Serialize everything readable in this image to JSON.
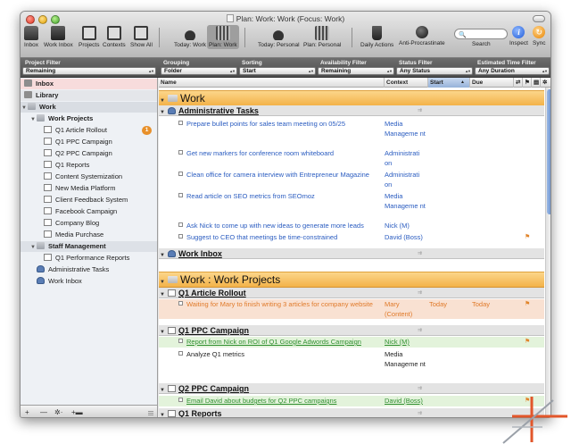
{
  "window": {
    "title": "Plan: Work: Work (Focus: Work)"
  },
  "toolbar": {
    "items": [
      {
        "label": "Inbox",
        "icon": "inbox-icon"
      },
      {
        "label": "Work Inbox",
        "icon": "work-inbox-icon"
      },
      {
        "label": "Projects",
        "icon": "projects-icon"
      },
      {
        "label": "Contexts",
        "icon": "contexts-icon"
      },
      {
        "label": "Show All",
        "icon": "show-all-icon"
      },
      {
        "label": "Today: Work",
        "icon": "flame-icon"
      },
      {
        "label": "Plan: Work",
        "icon": "plan-icon"
      },
      {
        "label": "Today: Personal",
        "icon": "flame-icon"
      },
      {
        "label": "Plan: Personal",
        "icon": "plan-icon"
      },
      {
        "label": "Daily Actions",
        "icon": "coffee-icon"
      },
      {
        "label": "Anti-Procrastinate",
        "icon": "ball-icon"
      },
      {
        "label": "Search",
        "icon": "search-icon"
      },
      {
        "label": "Inspect",
        "icon": "info-icon"
      },
      {
        "label": "Sync",
        "icon": "sync-icon"
      }
    ],
    "search_placeholder": "",
    "search_glyph": "🔍",
    "info_glyph": "i",
    "sync_glyph": "↻"
  },
  "filters": {
    "project_filter": {
      "label": "Project Filter",
      "value": "Remaining"
    },
    "grouping": {
      "label": "Grouping",
      "value": "Folder"
    },
    "sorting": {
      "label": "Sorting",
      "value": "Start"
    },
    "availability": {
      "label": "Availability Filter",
      "value": "Remaining"
    },
    "status": {
      "label": "Status Filter",
      "value": "Any Status"
    },
    "estimated": {
      "label": "Estimated Time Filter",
      "value": "Any Duration"
    }
  },
  "sidebar": {
    "inbox": "Inbox",
    "library": "Library",
    "work": "Work",
    "work_projects": "Work Projects",
    "items": [
      {
        "label": "Q1 Article Rollout",
        "badge": "1"
      },
      {
        "label": "Q1 PPC Campaign"
      },
      {
        "label": "Q2 PPC Campaign"
      },
      {
        "label": "Q1 Reports"
      },
      {
        "label": "Content Systemization"
      },
      {
        "label": "New Media Platform"
      },
      {
        "label": "Client Feedback System"
      },
      {
        "label": "Facebook Campaign"
      },
      {
        "label": "Company Blog"
      },
      {
        "label": "Media Purchase"
      }
    ],
    "staff_management": "Staff Management",
    "staff_items": [
      {
        "label": "Q1 Performance Reports"
      }
    ],
    "admin_tasks": "Administrative Tasks",
    "work_inbox": "Work Inbox",
    "bottom": {
      "add": "+",
      "remove": "—",
      "gear": "✲·",
      "add_folder": "+▬"
    }
  },
  "columns": {
    "name": "Name",
    "context": "Context",
    "start": "Start",
    "due": "Due"
  },
  "outline": {
    "band1": "Work",
    "admin_group": "Administrative Tasks",
    "admin_tasks": [
      {
        "name": "Prepare bullet points for sales team meeting on 05/25",
        "context": "Media Manageme nt"
      },
      {
        "name": "Get new markers for conference room whiteboard",
        "context": "Administrati on"
      },
      {
        "name": "Clean office for camera interview with Entrepreneur Magazine",
        "context": "Administrati on"
      },
      {
        "name": "Read article on SEO metrics from SEOmoz",
        "context": "Media Manageme nt"
      },
      {
        "name": "Ask Nick to come up with new ideas to generate more leads",
        "context": "Nick (M)"
      },
      {
        "name": "Suggest to CEO that meetings be time-constrained",
        "context": "David (Boss)",
        "flag": "⚑"
      }
    ],
    "work_inbox_group": "Work Inbox",
    "band2": "Work : Work Projects",
    "q1_article_group": "Q1 Article Rollout",
    "q1_article_tasks": [
      {
        "name": "Waiting for Mary to finish writing 3 articles for company website",
        "context": "Mary (Content)",
        "start": "Today",
        "due": "Today",
        "flag": "⚑"
      }
    ],
    "q1_ppc_group": "Q1 PPC Campaign",
    "q1_ppc_tasks": [
      {
        "name": "Report from Nick on ROI of Q1 Google Adwords Campaign",
        "context": "Nick (M)",
        "flag": "⚑"
      },
      {
        "name": "Analyze Q1 metrics",
        "context": "Media Manageme nt"
      }
    ],
    "q2_ppc_group": "Q2 PPC Campaign",
    "q2_ppc_tasks": [
      {
        "name": "Email David about budgets for Q2 PPC campaigns",
        "context": "David (Boss)",
        "flag": "⚑"
      }
    ],
    "q1_reports_group": "Q1 Reports",
    "group_marker": "⇉",
    "disclosure_open": "▼"
  }
}
